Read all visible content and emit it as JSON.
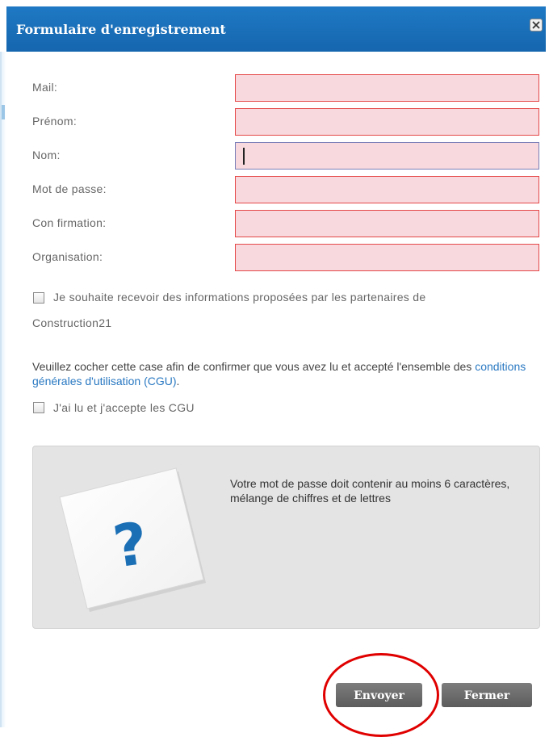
{
  "dialog": {
    "title": "Formulaire d'enregistrement",
    "close_icon": "close-x-icon"
  },
  "form": {
    "fields": [
      {
        "label": "Mail:",
        "value": "",
        "placeholder": ""
      },
      {
        "label": "Prénom:",
        "value": "",
        "placeholder": ""
      },
      {
        "label": "Nom:",
        "value": "",
        "placeholder": ""
      },
      {
        "label": "Mot de passe:",
        "value": "",
        "placeholder": ""
      },
      {
        "label": "Con firmation:",
        "value": "",
        "placeholder": ""
      },
      {
        "label": "Organisation:",
        "value": "",
        "placeholder": ""
      }
    ],
    "partners_checkbox_line1": "Je souhaite recevoir des informations proposées par les partenaires de",
    "partners_checkbox_line2": "Construction21",
    "cgu_text_before": "Veuillez cocher cette case afin de confirmer que vous avez lu et accepté l'ensemble des ",
    "cgu_link": "conditions générales d'utilisation (CGU)",
    "cgu_text_after": ".",
    "cgu_checkbox_label": "J'ai lu et j'accepte les CGU"
  },
  "info": {
    "icon": "question-mark-icon",
    "text": "Votre mot de passe doit contenir au moins 6 caractères, mélange de chiffres et de lettres"
  },
  "buttons": {
    "send_label": "Envoyer",
    "close_label": "Fermer"
  },
  "colors": {
    "title_bar": "#1a6fb8",
    "input_error_bg": "#f7d9de",
    "input_error_border": "#e54848",
    "link": "#2a79c2",
    "button": "#6b6b6b",
    "annotation": "#e00000"
  }
}
